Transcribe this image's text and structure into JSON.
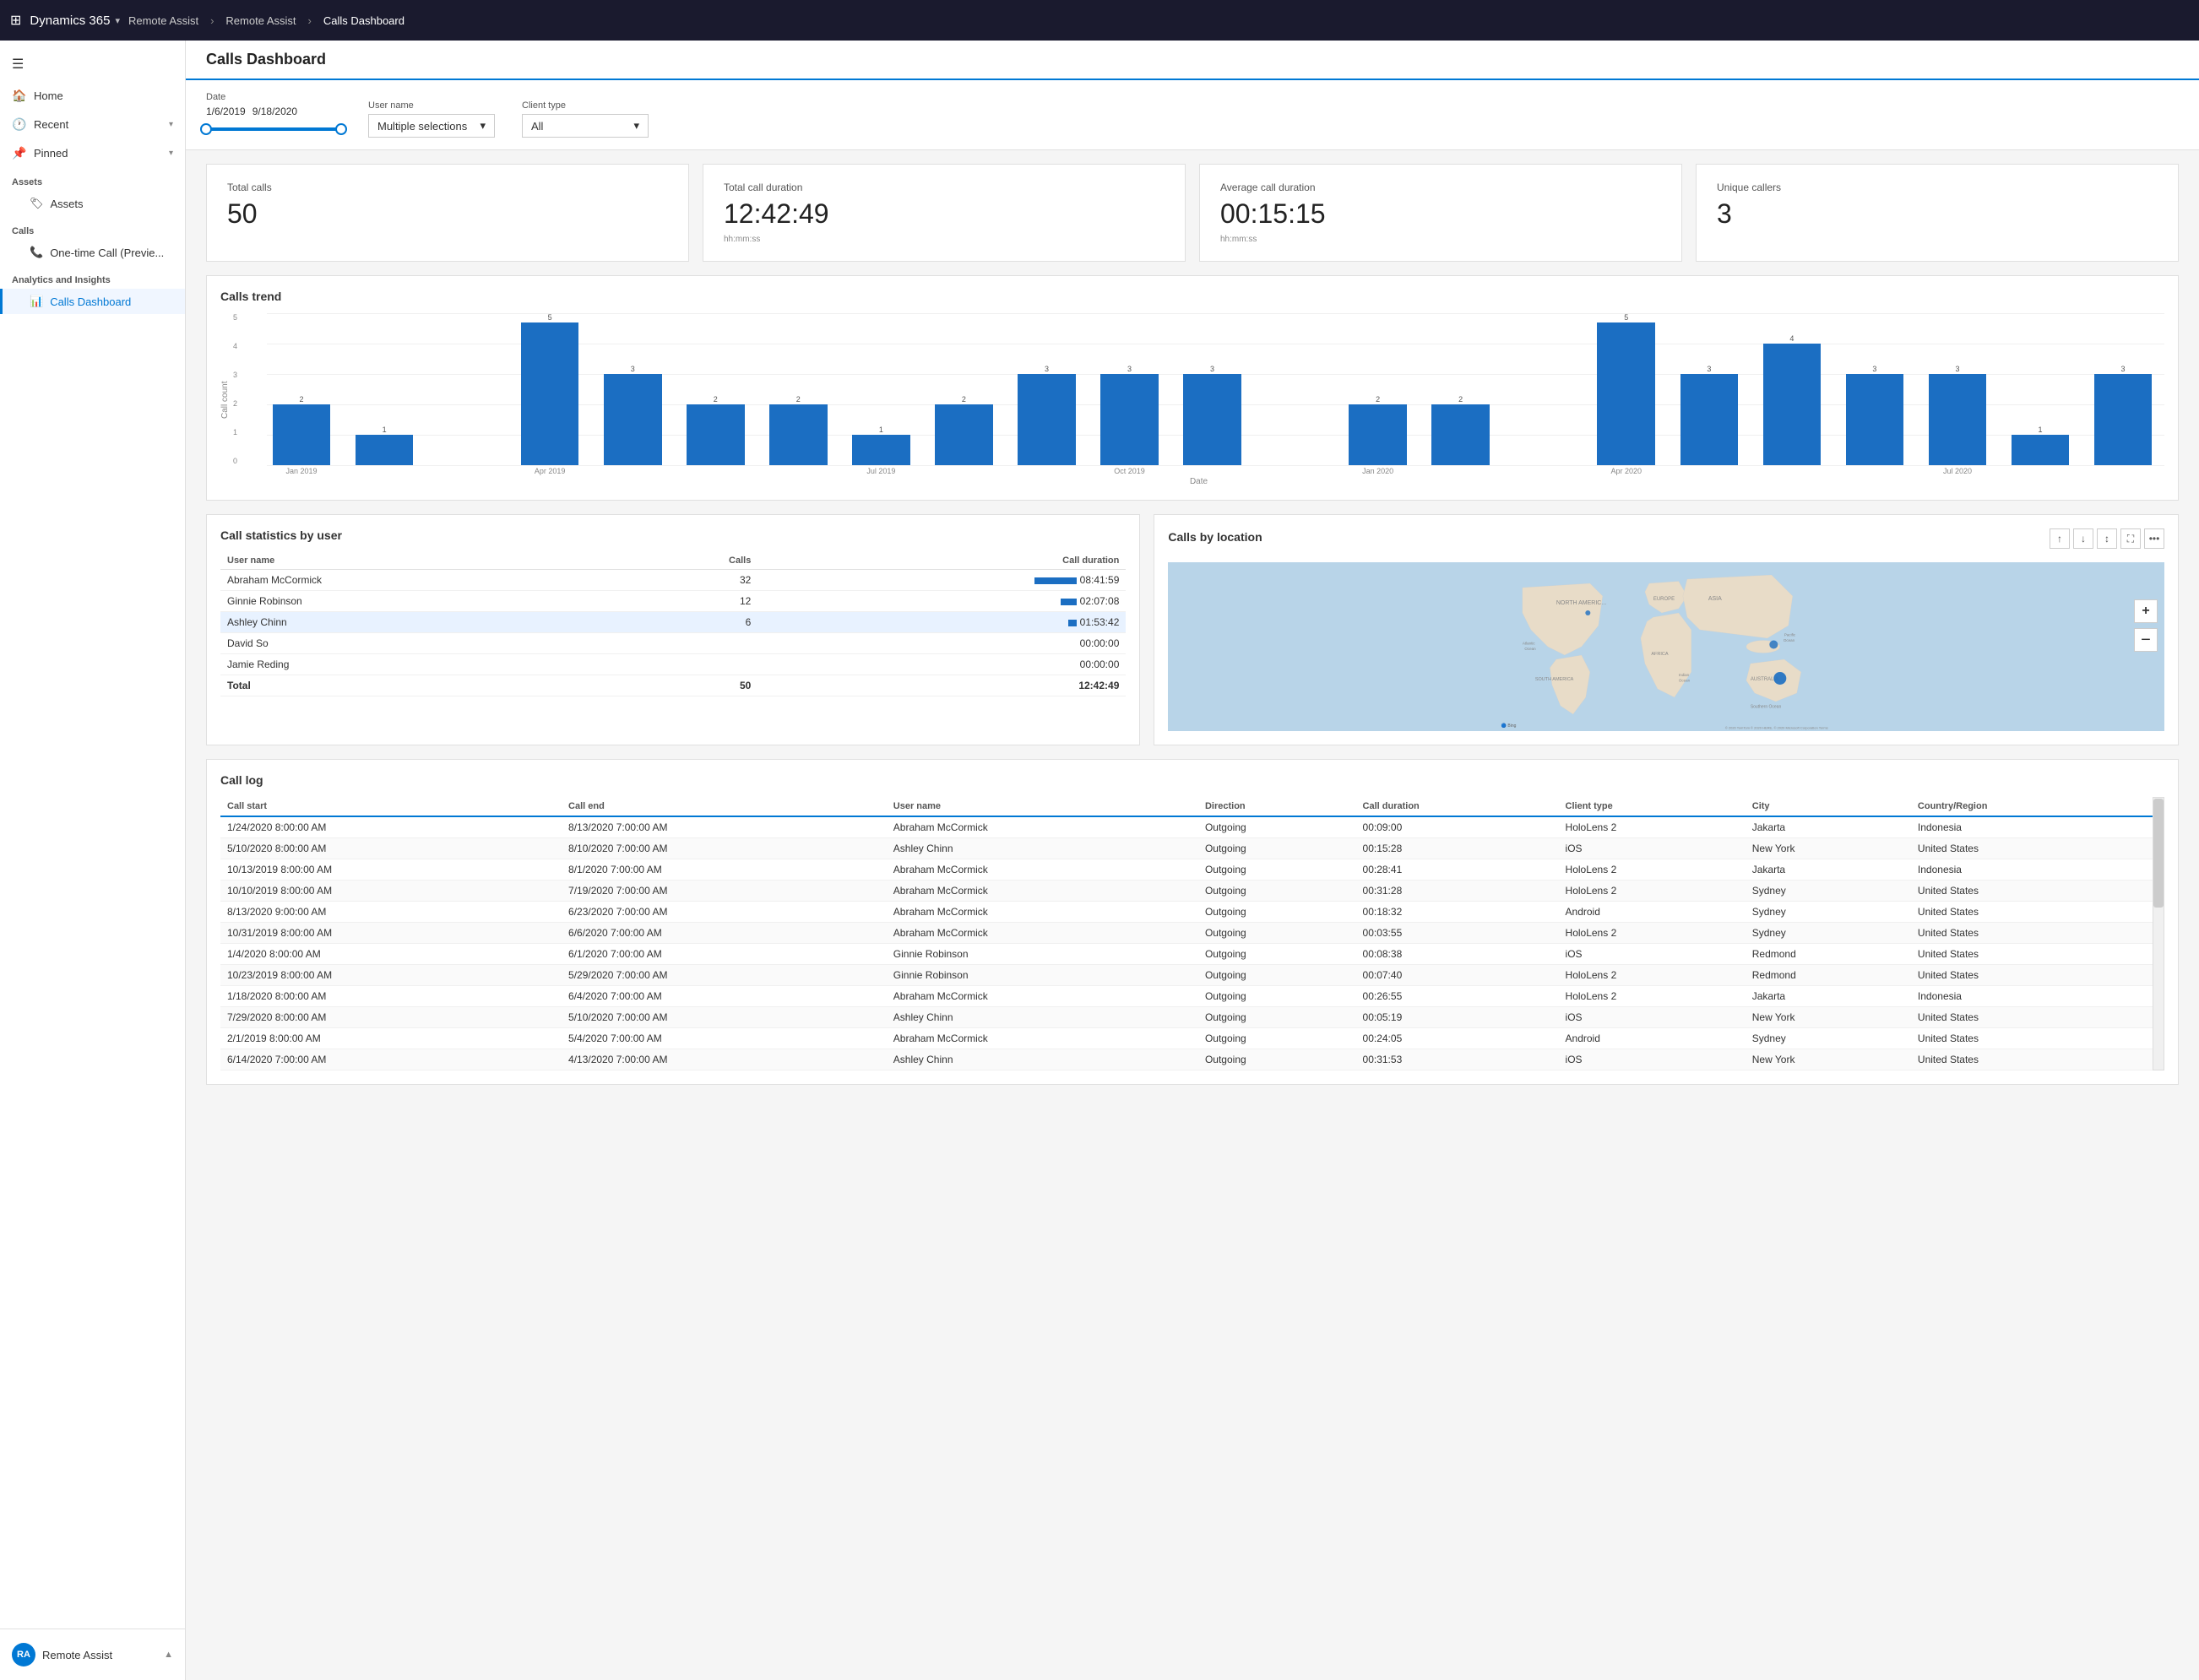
{
  "topNav": {
    "waffle": "⊞",
    "brand": "Dynamics 365",
    "brandChevron": "▾",
    "app1": "Remote Assist",
    "app2": "Remote Assist",
    "current": "Calls Dashboard"
  },
  "sidebar": {
    "hamburger": "☰",
    "navItems": [
      {
        "id": "home",
        "icon": "🏠",
        "label": "Home",
        "hasChevron": false
      },
      {
        "id": "recent",
        "icon": "🕐",
        "label": "Recent",
        "hasChevron": true
      },
      {
        "id": "pinned",
        "icon": "📌",
        "label": "Pinned",
        "hasChevron": true
      }
    ],
    "sections": [
      {
        "label": "Assets",
        "items": [
          {
            "id": "assets",
            "icon": "🏷",
            "label": "Assets"
          }
        ]
      },
      {
        "label": "Calls",
        "items": [
          {
            "id": "onetime-call",
            "icon": "📞",
            "label": "One-time Call (Previe..."
          }
        ]
      },
      {
        "label": "Analytics and Insights",
        "items": [
          {
            "id": "calls-dashboard",
            "icon": "📊",
            "label": "Calls Dashboard",
            "active": true
          }
        ]
      }
    ],
    "bottom": {
      "avatar": "RA",
      "label": "Remote Assist",
      "chevron": "▲"
    }
  },
  "page": {
    "title": "Calls Dashboard"
  },
  "filters": {
    "dateLabel": "Date",
    "dateFrom": "1/6/2019",
    "dateTo": "9/18/2020",
    "userNameLabel": "User name",
    "userNameValue": "Multiple selections",
    "clientTypeLabel": "Client type",
    "clientTypeValue": "All"
  },
  "kpis": [
    {
      "id": "total-calls",
      "label": "Total calls",
      "value": "50",
      "sub": ""
    },
    {
      "id": "total-duration",
      "label": "Total call duration",
      "value": "12:42:49",
      "sub": "hh:mm:ss"
    },
    {
      "id": "avg-duration",
      "label": "Average call duration",
      "value": "00:15:15",
      "sub": "hh:mm:ss"
    },
    {
      "id": "unique-callers",
      "label": "Unique callers",
      "value": "3",
      "sub": ""
    }
  ],
  "callsTrend": {
    "title": "Calls trend",
    "yAxisLabel": "Call count",
    "xAxisLabel": "Date",
    "yTicks": [
      "0",
      "1",
      "2",
      "3",
      "4",
      "5"
    ],
    "bars": [
      {
        "label": "Jan 2019",
        "value": 2
      },
      {
        "label": "",
        "value": 1
      },
      {
        "label": "",
        "value": 0
      },
      {
        "label": "Apr 2019",
        "value": 5
      },
      {
        "label": "",
        "value": 3
      },
      {
        "label": "",
        "value": 2
      },
      {
        "label": "",
        "value": 2
      },
      {
        "label": "Jul 2019",
        "value": 1
      },
      {
        "label": "",
        "value": 2
      },
      {
        "label": "",
        "value": 3
      },
      {
        "label": "Oct 2019",
        "value": 3
      },
      {
        "label": "",
        "value": 3
      },
      {
        "label": "",
        "value": 0
      },
      {
        "label": "Jan 2020",
        "value": 2
      },
      {
        "label": "",
        "value": 2
      },
      {
        "label": "",
        "value": 0
      },
      {
        "label": "Apr 2020",
        "value": 5
      },
      {
        "label": "",
        "value": 3
      },
      {
        "label": "",
        "value": 4
      },
      {
        "label": "",
        "value": 3
      },
      {
        "label": "Jul 2020",
        "value": 3
      },
      {
        "label": "",
        "value": 1
      },
      {
        "label": "",
        "value": 3
      }
    ]
  },
  "callStatsByUser": {
    "title": "Call statistics by user",
    "headers": [
      "User name",
      "Calls",
      "Call duration"
    ],
    "rows": [
      {
        "name": "Abraham McCormick",
        "calls": 32,
        "duration": "08:41:59",
        "barWidth": 100
      },
      {
        "name": "Ginnie Robinson",
        "calls": 12,
        "duration": "02:07:08",
        "barWidth": 38
      },
      {
        "name": "Ashley Chinn",
        "calls": 6,
        "duration": "01:53:42",
        "barWidth": 20
      },
      {
        "name": "David So",
        "calls": "",
        "duration": "00:00:00",
        "barWidth": 0
      },
      {
        "name": "Jamie Reding",
        "calls": "",
        "duration": "00:00:00",
        "barWidth": 0
      }
    ],
    "total": {
      "label": "Total",
      "calls": 50,
      "duration": "12:42:49"
    }
  },
  "callsByLocation": {
    "title": "Calls by location",
    "mapAlt": "World map showing call locations"
  },
  "callLog": {
    "title": "Call log",
    "headers": [
      "Call start",
      "Call end",
      "User name",
      "Direction",
      "Call duration",
      "Client type",
      "City",
      "Country/Region"
    ],
    "rows": [
      {
        "start": "1/24/2020 8:00:00 AM",
        "end": "8/13/2020 7:00:00 AM",
        "user": "Abraham McCormick",
        "dir": "Outgoing",
        "dur": "00:09:00",
        "client": "HoloLens 2",
        "city": "Jakarta",
        "country": "Indonesia"
      },
      {
        "start": "5/10/2020 8:00:00 AM",
        "end": "8/10/2020 7:00:00 AM",
        "user": "Ashley Chinn",
        "dir": "Outgoing",
        "dur": "00:15:28",
        "client": "iOS",
        "city": "New York",
        "country": "United States"
      },
      {
        "start": "10/13/2019 8:00:00 AM",
        "end": "8/1/2020 7:00:00 AM",
        "user": "Abraham McCormick",
        "dir": "Outgoing",
        "dur": "00:28:41",
        "client": "HoloLens 2",
        "city": "Jakarta",
        "country": "Indonesia"
      },
      {
        "start": "10/10/2019 8:00:00 AM",
        "end": "7/19/2020 7:00:00 AM",
        "user": "Abraham McCormick",
        "dir": "Outgoing",
        "dur": "00:31:28",
        "client": "HoloLens 2",
        "city": "Sydney",
        "country": "United States"
      },
      {
        "start": "8/13/2020 9:00:00 AM",
        "end": "6/23/2020 7:00:00 AM",
        "user": "Abraham McCormick",
        "dir": "Outgoing",
        "dur": "00:18:32",
        "client": "Android",
        "city": "Sydney",
        "country": "United States"
      },
      {
        "start": "10/31/2019 8:00:00 AM",
        "end": "6/6/2020 7:00:00 AM",
        "user": "Abraham McCormick",
        "dir": "Outgoing",
        "dur": "00:03:55",
        "client": "HoloLens 2",
        "city": "Sydney",
        "country": "United States"
      },
      {
        "start": "1/4/2020 8:00:00 AM",
        "end": "6/1/2020 7:00:00 AM",
        "user": "Ginnie Robinson",
        "dir": "Outgoing",
        "dur": "00:08:38",
        "client": "iOS",
        "city": "Redmond",
        "country": "United States"
      },
      {
        "start": "10/23/2019 8:00:00 AM",
        "end": "5/29/2020 7:00:00 AM",
        "user": "Ginnie Robinson",
        "dir": "Outgoing",
        "dur": "00:07:40",
        "client": "HoloLens 2",
        "city": "Redmond",
        "country": "United States"
      },
      {
        "start": "1/18/2020 8:00:00 AM",
        "end": "6/4/2020 7:00:00 AM",
        "user": "Abraham McCormick",
        "dir": "Outgoing",
        "dur": "00:26:55",
        "client": "HoloLens 2",
        "city": "Jakarta",
        "country": "Indonesia"
      },
      {
        "start": "7/29/2020 8:00:00 AM",
        "end": "5/10/2020 7:00:00 AM",
        "user": "Ashley Chinn",
        "dir": "Outgoing",
        "dur": "00:05:19",
        "client": "iOS",
        "city": "New York",
        "country": "United States"
      },
      {
        "start": "2/1/2019 8:00:00 AM",
        "end": "5/4/2020 7:00:00 AM",
        "user": "Abraham McCormick",
        "dir": "Outgoing",
        "dur": "00:24:05",
        "client": "Android",
        "city": "Sydney",
        "country": "United States"
      },
      {
        "start": "6/14/2020 7:00:00 AM",
        "end": "4/13/2020 7:00:00 AM",
        "user": "Ashley Chinn",
        "dir": "Outgoing",
        "dur": "00:31:53",
        "client": "iOS",
        "city": "New York",
        "country": "United States"
      }
    ]
  }
}
